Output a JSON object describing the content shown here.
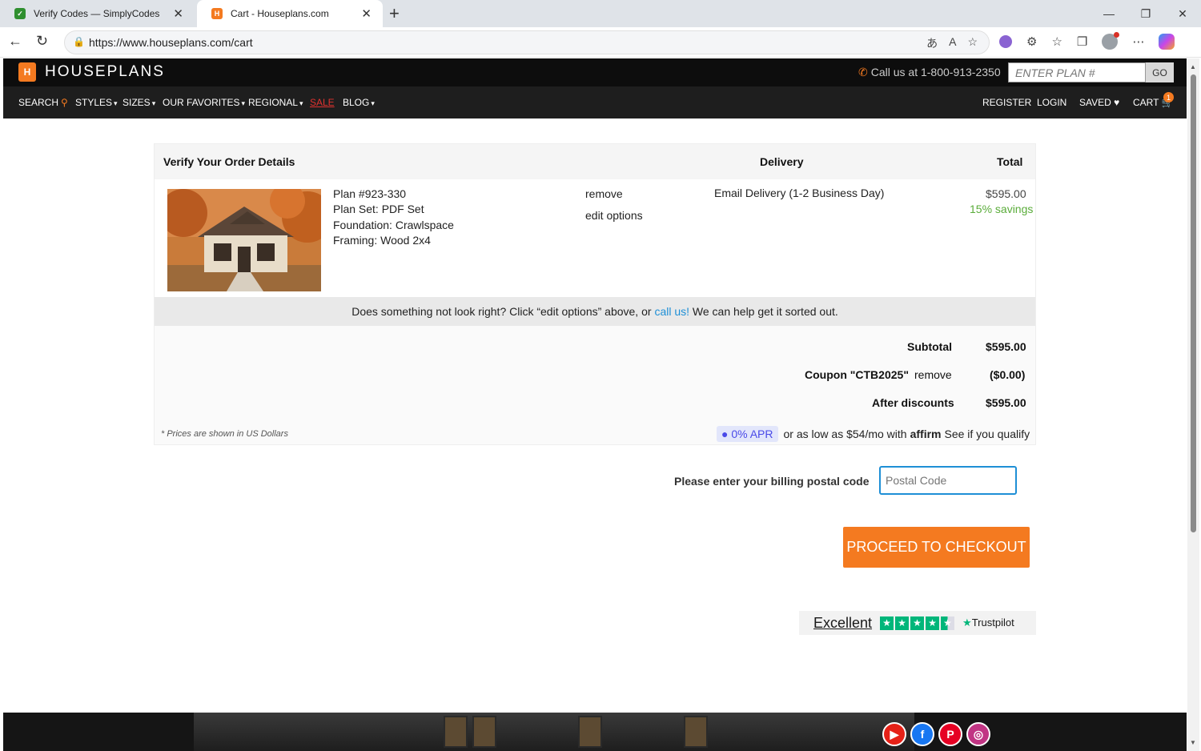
{
  "browser": {
    "tabs": [
      {
        "title": "Verify Codes — SimplyCodes"
      },
      {
        "title": "Cart - Houseplans.com"
      }
    ],
    "url": "https://www.houseplans.com/cart"
  },
  "site": {
    "logo_text": "HOUSEPLANS",
    "call_text": "Call us at 1-800-913-2350",
    "plan_placeholder": "ENTER PLAN #",
    "go_label": "GO",
    "nav": {
      "search": "SEARCH",
      "styles": "STYLES",
      "sizes": "SIZES",
      "favorites": "OUR FAVORITES",
      "regional": "REGIONAL",
      "sale": "SALE",
      "blog": "BLOG",
      "register": "REGISTER",
      "login": "LOGIN",
      "saved": "SAVED",
      "cart": "CART",
      "cart_count": "1"
    }
  },
  "cart": {
    "header": {
      "details": "Verify Your Order Details",
      "delivery": "Delivery",
      "total": "Total"
    },
    "item": {
      "plan": "Plan #923-330",
      "plan_set": "Plan Set: PDF Set",
      "foundation": "Foundation: Crawlspace",
      "framing": "Framing: Wood 2x4",
      "remove": "remove",
      "edit": "edit options",
      "delivery": "Email Delivery (1-2 Business Day)",
      "price": "$595.00",
      "savings": "15% savings"
    },
    "help": {
      "before": "Does something not look right?  Click “edit options” above, or ",
      "link": "call us!",
      "after": "  We can help get it sorted out."
    },
    "totals": {
      "subtotal_label": "Subtotal",
      "subtotal_value": "$595.00",
      "coupon_label": "Coupon \"CTB2025\"",
      "coupon_remove": "remove",
      "coupon_value": "($0.00)",
      "after_label": "After discounts",
      "after_value": "$595.00"
    },
    "note": "* Prices are shown in US Dollars",
    "affirm": {
      "apr": "0% APR",
      "text": "or as low as $54/mo with",
      "brand": "affirm",
      "qualify": "See if you qualify"
    }
  },
  "billing": {
    "label": "Please enter your billing postal code",
    "placeholder": "Postal Code"
  },
  "checkout_label": "PROCEED TO CHECKOUT",
  "trustpilot": {
    "rating": "Excellent",
    "brand": "Trustpilot"
  },
  "colors": {
    "accent": "#f47a20",
    "link": "#1e8fd6",
    "savings": "#5aac3a"
  }
}
